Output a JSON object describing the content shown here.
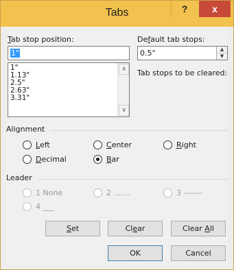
{
  "dialog": {
    "title": "Tabs",
    "help_glyph": "?",
    "close_glyph": "x"
  },
  "tab_stop": {
    "label_u": "T",
    "label_rest": "ab stop position:",
    "value": "1\"",
    "list": [
      "1\"",
      "1.13\"",
      "2.5\"",
      "2.63\"",
      "3.31\""
    ]
  },
  "default_tab": {
    "label_pre": "De",
    "label_u": "f",
    "label_rest": "ault tab stops:",
    "value": "0.5\""
  },
  "cleared_label": "Tab stops to be cleared:",
  "alignment": {
    "label": "Alignment",
    "options": [
      {
        "u": "L",
        "rest": "eft",
        "selected": false
      },
      {
        "u": "C",
        "rest": "enter",
        "selected": false
      },
      {
        "u": "R",
        "rest": "ight",
        "selected": false
      },
      {
        "u": "D",
        "rest": "ecimal",
        "selected": false
      },
      {
        "u": "B",
        "rest": "ar",
        "selected": true
      }
    ]
  },
  "leader": {
    "label": "Leader",
    "options": [
      "1 None",
      "2 .......",
      "3 -------",
      "4 ___"
    ],
    "enabled": false
  },
  "buttons": {
    "set": {
      "u": "S",
      "rest": "et"
    },
    "clear": {
      "pre": "Cl",
      "u": "e",
      "rest": "ar"
    },
    "clear_all": {
      "pre": "Clear ",
      "u": "A",
      "rest": "ll"
    },
    "ok": "OK",
    "cancel": "Cancel"
  },
  "colors": {
    "titlebar": "#f1c24d",
    "close": "#c74a39",
    "selection": "#3399ff"
  }
}
